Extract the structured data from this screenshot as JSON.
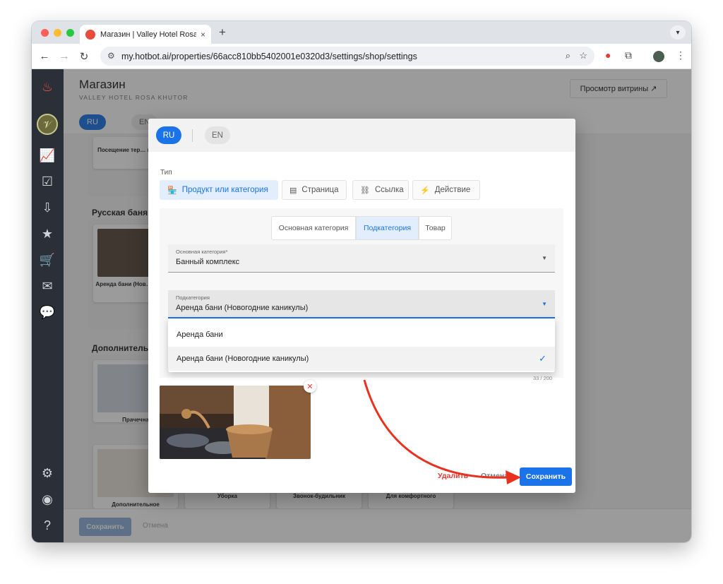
{
  "browser": {
    "tab_title": "Магазин | Valley Hotel Rosa K",
    "tab_close": "×",
    "new_tab": "+",
    "url": "my.hotbot.ai/properties/66acc810bb5402001e0320d3/settings/shop/settings"
  },
  "header": {
    "title": "Магазин",
    "subtitle": "VALLEY HOTEL ROSA KHUTOR",
    "storefront_button": "Просмотр витрины ↗"
  },
  "page_langs": {
    "ru": "RU",
    "en": "EN"
  },
  "background": {
    "group_russian_bath": "Русская баня",
    "group_additional": "Дополнительн",
    "cards": {
      "visit": "Посещение тер… комплекс",
      "bath_rent": "Аренда бани (Нов… каникул",
      "laundry": "Прачечна",
      "additional": "Дополнительное",
      "cleaning": "Уборка",
      "wakeup": "Звонок-будильник",
      "comfort": "Для комфортного"
    }
  },
  "footer": {
    "save": "Сохранить",
    "cancel": "Отмена"
  },
  "dialog": {
    "langs": {
      "ru": "RU",
      "en": "EN"
    },
    "type_label": "Тип",
    "types": [
      {
        "label": "Продукт или категория",
        "icon": "store-icon"
      },
      {
        "label": "Страница",
        "icon": "page-icon"
      },
      {
        "label": "Ссылка",
        "icon": "link-icon"
      },
      {
        "label": "Действие",
        "icon": "bolt-icon"
      }
    ],
    "segments": [
      "Основная категория",
      "Подкатегория",
      "Товар"
    ],
    "main_category": {
      "label": "Основная категория*",
      "value": "Банный комплекс"
    },
    "subcategory": {
      "label": "Подкатегория",
      "value": "Аренда бани (Новогодние каникулы)"
    },
    "options": [
      "Аренда бани",
      "Аренда бани (Новогодние каникулы)"
    ],
    "counter": "33 / 200",
    "actions": {
      "delete": "Удалить",
      "cancel": "Отмена",
      "save": "Сохранить"
    }
  },
  "colors": {
    "accent": "#1a73e8",
    "danger": "#e53935",
    "sidebar": "#2a2f38"
  }
}
